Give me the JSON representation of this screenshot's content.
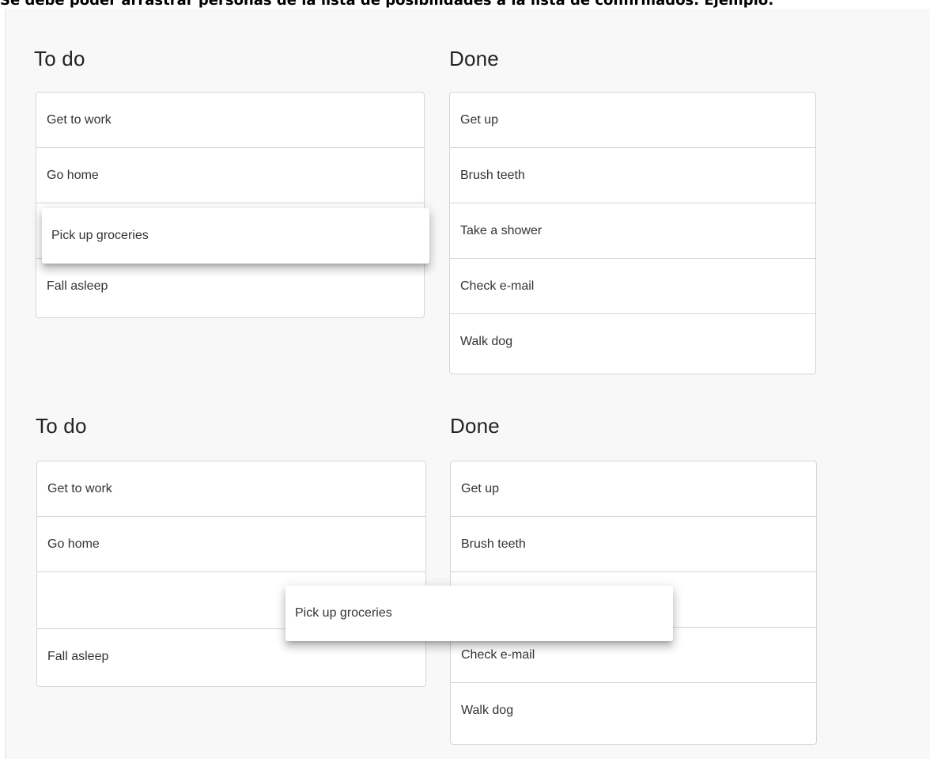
{
  "caption": "Se debe poder arrastrar personas de la lista de posibilidades a la lista de confirmados. Ejemplo:",
  "examples": [
    {
      "todo": {
        "title": "To do",
        "items": [
          "Get to work",
          "Go home",
          "",
          "Fall asleep"
        ]
      },
      "done": {
        "title": "Done",
        "items": [
          "Get up",
          "Brush teeth",
          "Take a shower",
          "Check e-mail",
          "Walk dog"
        ]
      },
      "dragging": "Pick up groceries"
    },
    {
      "todo": {
        "title": "To do",
        "items": [
          "Get to work",
          "Go home",
          "",
          "Fall asleep"
        ]
      },
      "done": {
        "title": "Done",
        "items": [
          "Get up",
          "Brush teeth",
          "",
          "Check e-mail",
          "Walk dog"
        ]
      },
      "dragging": "Pick up groceries"
    }
  ]
}
